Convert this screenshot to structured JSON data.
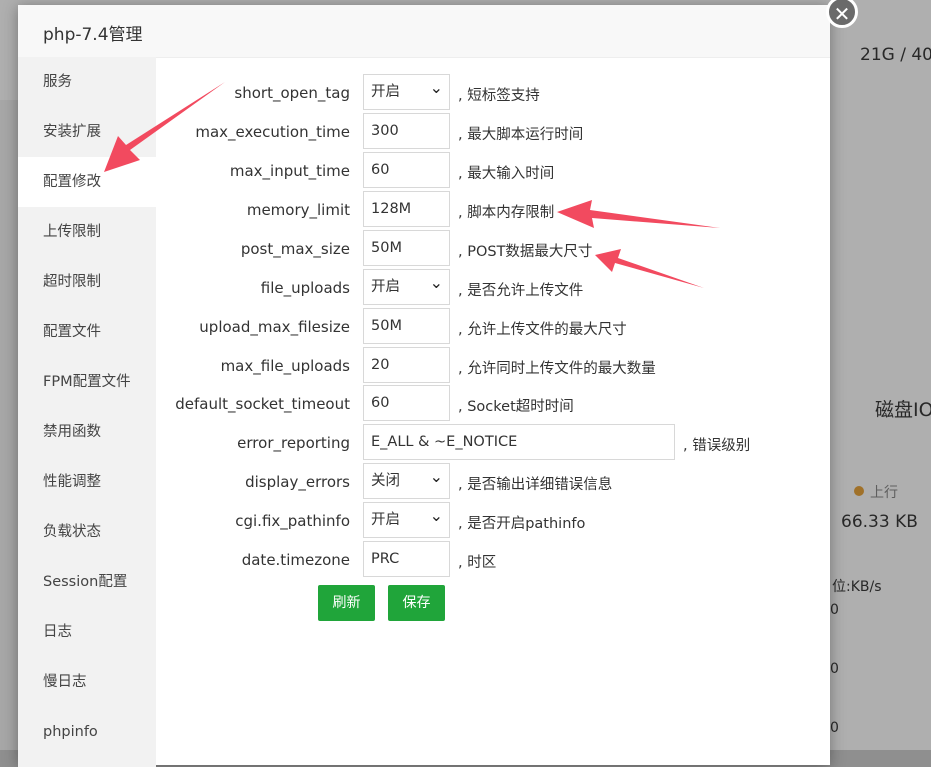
{
  "title": "php-7.4管理",
  "sidebar": [
    "服务",
    "安装扩展",
    "配置修改",
    "上传限制",
    "超时限制",
    "配置文件",
    "FPM配置文件",
    "禁用函数",
    "性能调整",
    "负载状态",
    "Session配置",
    "日志",
    "慢日志",
    "phpinfo"
  ],
  "settings": [
    {
      "name": "short_open_tag",
      "value": "开启",
      "type": "select",
      "hint": ", 短标签支持"
    },
    {
      "name": "max_execution_time",
      "value": "300",
      "type": "input",
      "hint": ", 最大脚本运行时间"
    },
    {
      "name": "max_input_time",
      "value": "60",
      "type": "input",
      "hint": ", 最大输入时间"
    },
    {
      "name": "memory_limit",
      "value": "128M",
      "type": "input",
      "hint": ", 脚本内存限制"
    },
    {
      "name": "post_max_size",
      "value": "50M",
      "type": "input",
      "hint": ", POST数据最大尺寸"
    },
    {
      "name": "file_uploads",
      "value": "开启",
      "type": "select",
      "hint": ", 是否允许上传文件"
    },
    {
      "name": "upload_max_filesize",
      "value": "50M",
      "type": "input",
      "hint": ", 允许上传文件的最大尺寸"
    },
    {
      "name": "max_file_uploads",
      "value": "20",
      "type": "input",
      "hint": ", 允许同时上传文件的最大数量"
    },
    {
      "name": "default_socket_timeout",
      "value": "60",
      "type": "input",
      "hint": ", Socket超时时间"
    },
    {
      "name": "error_reporting",
      "value": "E_ALL & ~E_NOTICE",
      "type": "wide",
      "hint": ", 错误级别"
    },
    {
      "name": "display_errors",
      "value": "关闭",
      "type": "select",
      "hint": ", 是否输出详细错误信息"
    },
    {
      "name": "cgi.fix_pathinfo",
      "value": "开启",
      "type": "select",
      "hint": ", 是否开启pathinfo"
    },
    {
      "name": "date.timezone",
      "value": "PRC",
      "type": "input",
      "hint": ", 时区"
    }
  ],
  "buttons": {
    "refresh": "刷新",
    "save": "保存"
  },
  "background": {
    "disk_usage": "21G / 40",
    "disk_io_title": "磁盘IO",
    "upload_legend": "上行",
    "upload_value": "66.33 KB",
    "unit_label": "位:KB/s",
    "axis_zero": "0"
  },
  "colors": {
    "accent": "#20a53a",
    "annotation_arrow": "#f24a5f"
  }
}
